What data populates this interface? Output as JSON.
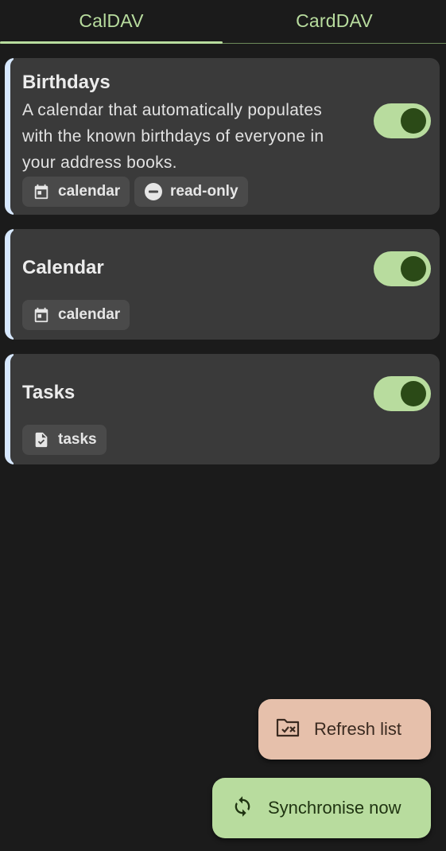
{
  "tabs": [
    {
      "label": "CalDAV",
      "selected": true
    },
    {
      "label": "CardDAV",
      "selected": false
    }
  ],
  "collections": [
    {
      "title": "Birthdays",
      "description_lines": [
        "A calendar that automatically populates",
        "with the known birthdays of everyone in",
        "your address books."
      ],
      "sync_enabled": true,
      "chips": [
        {
          "icon": "calendar-icon",
          "label": "calendar"
        },
        {
          "icon": "read-only-icon",
          "label": "read-only"
        }
      ]
    },
    {
      "title": "Calendar",
      "sync_enabled": true,
      "chips": [
        {
          "icon": "calendar-icon",
          "label": "calendar"
        }
      ]
    },
    {
      "title": "Tasks",
      "sync_enabled": true,
      "chips": [
        {
          "icon": "tasks-icon",
          "label": "tasks"
        }
      ]
    }
  ],
  "actions": {
    "refresh_label": "Refresh list",
    "sync_label": "Synchronise now"
  },
  "colors": {
    "background": "#1b1b1b",
    "accent_green": "#b8dc9e",
    "card": "#3a3a3a",
    "refresh_fab": "#e6c0ab"
  }
}
